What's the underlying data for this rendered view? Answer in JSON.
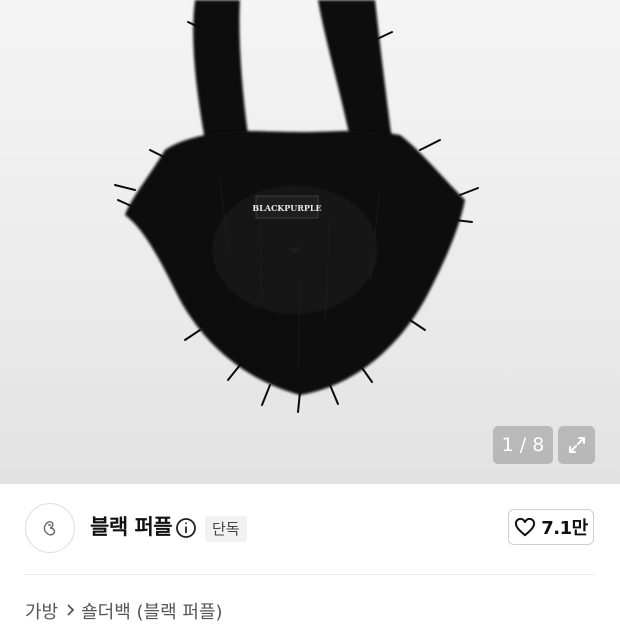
{
  "gallery": {
    "counter": "1 / 8",
    "product_label_text": "BLACKPURPLE",
    "icons": {
      "expand": "expand-arrows-icon"
    }
  },
  "brand": {
    "name": "블랙 퍼플",
    "badge": "단독",
    "like_count": "7.1만",
    "icons": {
      "info": "info-circle-icon",
      "like": "heart-outline-icon",
      "logo": "brand-logo-icon"
    }
  },
  "breadcrumb": {
    "items": [
      "가방",
      "숄더백 (블랙 퍼플)"
    ],
    "separator_icon": "chevron-right-icon"
  },
  "colors": {
    "counter_bg": "#969696",
    "badge_bg": "#f1f1f1"
  }
}
